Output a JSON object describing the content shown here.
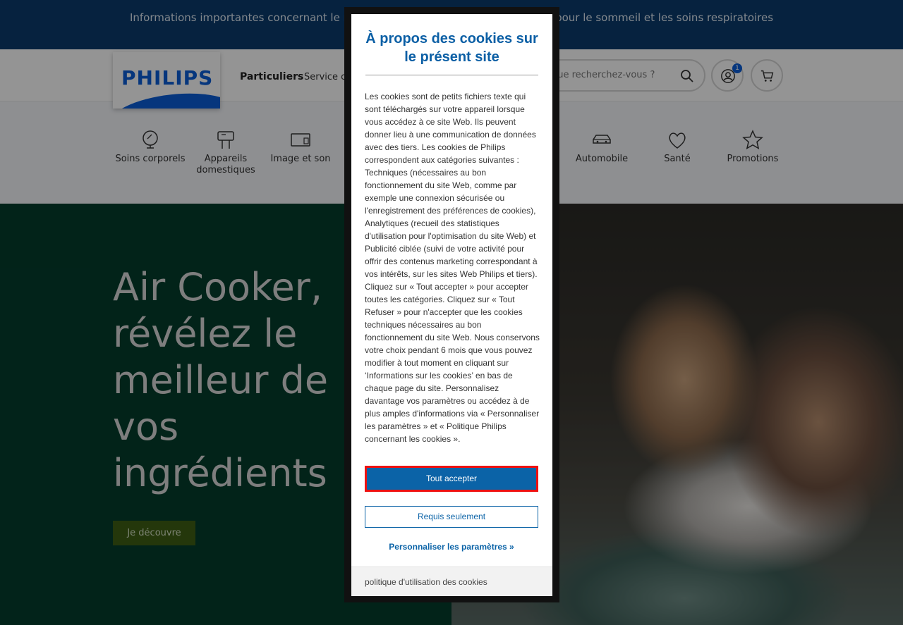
{
  "banner": {
    "text": "Informations importantes concernant le rappel des appareils Philips Respironics pour le sommeil et les soins respiratoires"
  },
  "header": {
    "logo_text": "PHILIPS",
    "nav_primary": "Particuliers",
    "nav_service": "Service client",
    "search_placeholder": "Que recherchez-vous ?",
    "account_badge": "1",
    "icons": [
      "search-icon",
      "user-icon",
      "cart-icon"
    ]
  },
  "categories": [
    {
      "label": "Soins corporels",
      "icon": "mirror-icon"
    },
    {
      "label": "Appareils domestiques",
      "icon": "mixer-icon"
    },
    {
      "label": "Image et son",
      "icon": "tv-icon"
    },
    {
      "label": "Automobile",
      "icon": "car-icon"
    },
    {
      "label": "Santé",
      "icon": "heart-icon"
    },
    {
      "label": "Promotions",
      "icon": "star-icon"
    }
  ],
  "hero": {
    "title": "Air Cooker, révélez le meilleur de vos ingrédients",
    "cta": "Je découvre"
  },
  "cookie_modal": {
    "title": "À propos des cookies sur le présent site",
    "body": "Les cookies sont de petits fichiers texte qui sont téléchargés sur votre appareil lorsque vous accédez à ce site Web. Ils peuvent donner lieu à une communication de données avec des tiers. Les cookies de Philips correspondent aux catégories suivantes : Techniques (nécessaires au bon fonctionnement du site Web, comme par exemple une connexion sécurisée ou l'enregistrement des préférences de cookies), Analytiques (recueil des statistiques d'utilisation pour l'optimisation du site Web) et Publicité ciblée (suivi de votre activité pour offrir des contenus marketing correspondant à vos intérêts, sur les sites Web Philips et tiers). Cliquez sur « Tout accepter » pour accepter toutes les catégories. Cliquez sur « Tout Refuser » pour n'accepter que les cookies techniques nécessaires au bon fonctionnement du site Web. Nous conservons votre choix pendant 6 mois que vous pouvez modifier à tout moment en cliquant sur ‘Informations sur les cookies’ en bas de chaque page du site. Personnalisez davantage vos paramètres ou accédez à de plus amples d'informations via « Personnaliser les paramètres » et « Politique Philips concernant les cookies ».",
    "accept_all": "Tout accepter",
    "required_only": "Requis seulement",
    "customize": "Personnaliser les paramètres »",
    "policy_link": "politique d'utilisation des cookies"
  },
  "colors": {
    "banner_bg": "#0b3c6d",
    "brand_blue": "#0b5ed7",
    "hero_bg": "#043d2c",
    "cta_bg": "#3f5f14",
    "modal_blue": "#0b63a7",
    "focus_outline": "#e11111"
  }
}
